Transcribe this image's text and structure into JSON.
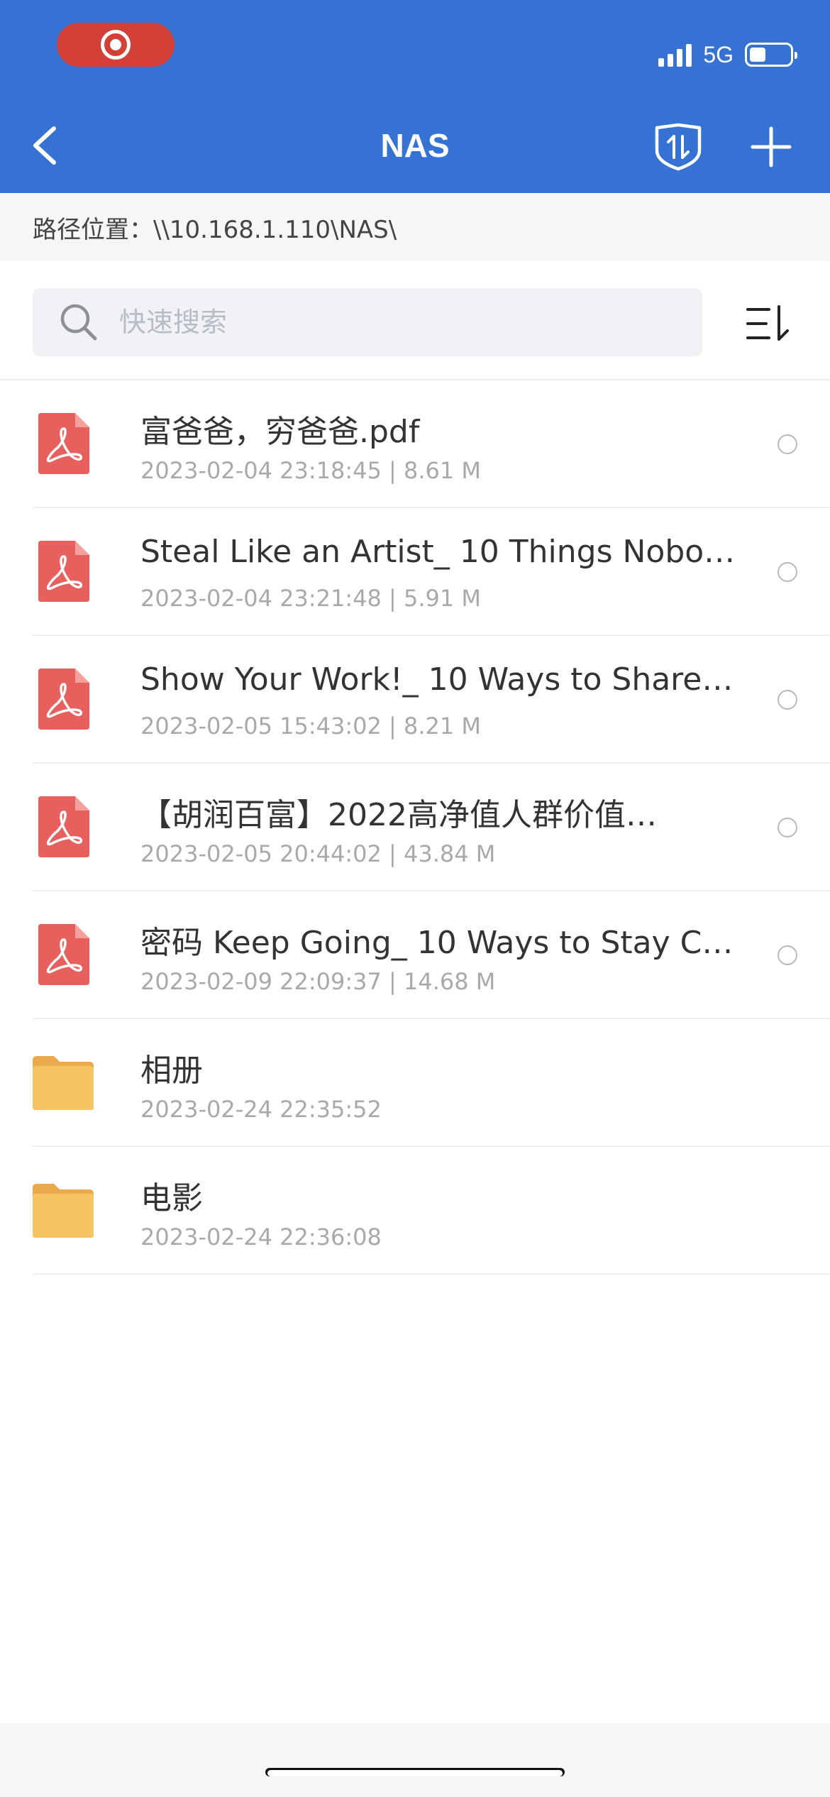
{
  "status_bar": {
    "network": "5G",
    "battery_level": 0.4
  },
  "nav": {
    "title": "NAS"
  },
  "path": {
    "label": "路径位置：\\\\10.168.1.110\\NAS\\"
  },
  "search": {
    "placeholder": "快速搜索"
  },
  "files": [
    {
      "type": "pdf",
      "name": "富爸爸，穷爸爸.pdf",
      "meta": "2023-02-04 23:18:45 | 8.61 M"
    },
    {
      "type": "pdf",
      "name": "Steal Like an Artist_ 10 Things Nobo…",
      "meta": "2023-02-04 23:21:48 | 5.91 M"
    },
    {
      "type": "pdf",
      "name": "Show Your Work!_ 10 Ways to Share…",
      "meta": "2023-02-05 15:43:02 | 8.21 M"
    },
    {
      "type": "pdf",
      "name": "【胡润百富】2022高净值人群价值…",
      "meta": "2023-02-05 20:44:02 | 43.84 M"
    },
    {
      "type": "pdf",
      "name": "密码 Keep Going_ 10 Ways to Stay C…",
      "meta": "2023-02-09 22:09:37 | 14.68 M"
    },
    {
      "type": "folder",
      "name": "相册",
      "meta": "2023-02-24 22:35:52"
    },
    {
      "type": "folder",
      "name": "电影",
      "meta": "2023-02-24 22:36:08"
    }
  ],
  "colors": {
    "header": "#3572d3",
    "record_pill": "#d34038",
    "pdf_icon": "#e8605d",
    "folder_icon": "#f5c564"
  },
  "icons": {
    "back": "chevron-left-icon",
    "shield": "shield-transfer-icon",
    "add": "plus-icon",
    "search": "search-icon",
    "sort": "sort-icon",
    "pdf": "pdf-file-icon",
    "folder": "folder-icon"
  }
}
